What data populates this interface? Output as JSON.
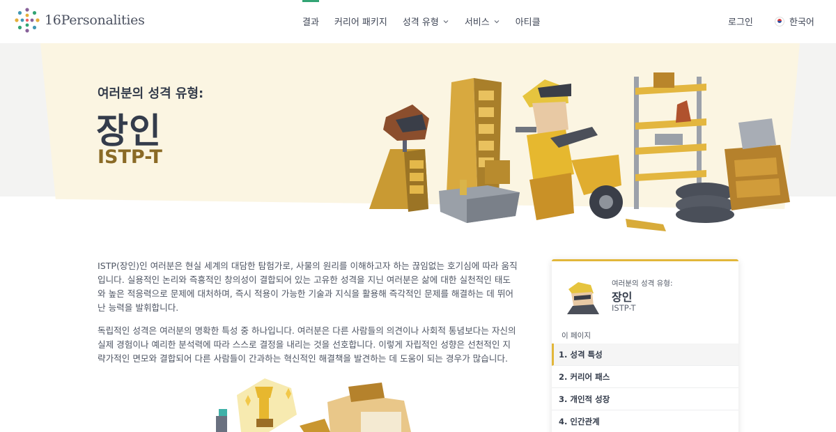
{
  "header": {
    "logo_text": "16Personalities",
    "nav": [
      {
        "label": "결과",
        "has_dropdown": false
      },
      {
        "label": "커리어 패키지",
        "has_dropdown": false
      },
      {
        "label": "성격 유형",
        "has_dropdown": true
      },
      {
        "label": "서비스",
        "has_dropdown": true
      },
      {
        "label": "아티클",
        "has_dropdown": false
      }
    ],
    "login": "로그인",
    "language": "한국어"
  },
  "hero": {
    "subtitle": "여러분의 성격 유형:",
    "title": "장인",
    "code": "ISTP-T"
  },
  "content": {
    "paragraph1": "ISTP(장인)인 여러분은 현실 세계의 대담한 탐험가로, 사물의 원리를 이해하고자 하는 끊임없는 호기심에 따라 움직입니다. 실용적인 논리와 즉흥적인 창의성이 결합되어 있는 고유한 성격을 지닌 여러분은 삶에 대한 실천적인 태도와 높은 적응력으로 문제에 대처하며, 즉시 적용이 가능한 기술과 지식을 활용해 즉각적인 문제를 해결하는 데 뛰어난 능력을 발휘합니다.",
    "paragraph2": "독립적인 성격은 여러분의 명확한 특성 중 하나입니다. 여러분은 다른 사람들의 의견이나 사회적 통념보다는 자신의 실제 경험이나 예리한 분석력에 따라 스스로 결정을 내리는 것을 선호합니다. 이렇게 자립적인 성향은 선천적인 지략가적인 면모와 결합되어 다른 사람들이 간과하는 혁신적인 해결책을 발견하는 데 도움이 되는 경우가 많습니다."
  },
  "sidebar": {
    "label": "여러분의 성격 유형:",
    "title": "장인",
    "code": "ISTP-T",
    "page_label": "이 페이지",
    "toc": [
      {
        "label": "1. 성격 특성",
        "active": true
      },
      {
        "label": "2. 커리어 패스",
        "active": false
      },
      {
        "label": "3. 개인적 성장",
        "active": false
      },
      {
        "label": "4. 인간관계",
        "active": false
      }
    ]
  },
  "colors": {
    "accent_green": "#33a474",
    "accent_gold": "#e2b73a",
    "hero_bg": "#fbf5e2",
    "code_brown": "#8a6a26"
  }
}
